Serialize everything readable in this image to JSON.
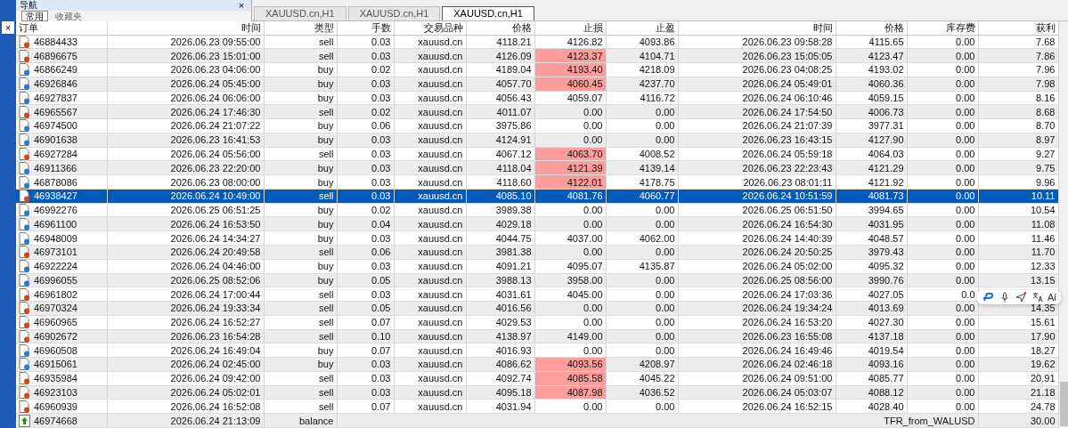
{
  "toolbox_close": "×",
  "navigator": {
    "title": "导航",
    "close": "×",
    "buttons": [
      "常用",
      "收藏夹"
    ]
  },
  "chart_tabs": [
    {
      "label": "XAUUSD.cn,H1",
      "selected": false
    },
    {
      "label": "XAUUSD.cn,H1",
      "selected": false
    },
    {
      "label": "XAUUSD.cn,H1",
      "selected": true
    }
  ],
  "table": {
    "columns": [
      "订单",
      "时间",
      "类型",
      "手数",
      "交易品种",
      "价格",
      "止损",
      "止盈",
      "时间",
      "价格",
      "库存费",
      "获利"
    ],
    "rows": [
      {
        "kind": "sell",
        "order": "46884433",
        "open_time": "2026.06.23 09:55:00",
        "type": "sell",
        "lots": "0.03",
        "symbol": "xauusd.cn",
        "price": "4118.21",
        "sl": "4126.82",
        "sl_highlight": false,
        "tp": "4093.86",
        "close_time": "2026.06.23 09:58:28",
        "close_price": "4115.65",
        "swap": "0.00",
        "profit": "7.68",
        "selected": false
      },
      {
        "kind": "sell",
        "order": "46896675",
        "open_time": "2026.06.23 15:01:00",
        "type": "sell",
        "lots": "0.03",
        "symbol": "xauusd.cn",
        "price": "4126.09",
        "sl": "4123.37",
        "sl_highlight": true,
        "tp": "4104.71",
        "close_time": "2026.06.23 15:05:05",
        "close_price": "4123.47",
        "swap": "0.00",
        "profit": "7.86",
        "selected": false
      },
      {
        "kind": "buy",
        "order": "46866249",
        "open_time": "2026.06.23 04:06:00",
        "type": "buy",
        "lots": "0.02",
        "symbol": "xauusd.cn",
        "price": "4189.04",
        "sl": "4193.40",
        "sl_highlight": true,
        "tp": "4218.09",
        "close_time": "2026.06.23 04:08:25",
        "close_price": "4193.02",
        "swap": "0.00",
        "profit": "7.96",
        "selected": false
      },
      {
        "kind": "buy",
        "order": "46926846",
        "open_time": "2026.06.24 05:45:00",
        "type": "buy",
        "lots": "0.03",
        "symbol": "xauusd.cn",
        "price": "4057.70",
        "sl": "4060.45",
        "sl_highlight": true,
        "tp": "4237.70",
        "close_time": "2026.06.24 05:49:01",
        "close_price": "4060.36",
        "swap": "0.00",
        "profit": "7.98",
        "selected": false
      },
      {
        "kind": "buy",
        "order": "46927837",
        "open_time": "2026.06.24 06:06:00",
        "type": "buy",
        "lots": "0.03",
        "symbol": "xauusd.cn",
        "price": "4056.43",
        "sl": "4059.07",
        "sl_highlight": false,
        "tp": "4116.72",
        "close_time": "2026.06.24 06:10:46",
        "close_price": "4059.15",
        "swap": "0.00",
        "profit": "8.16",
        "selected": false
      },
      {
        "kind": "sell",
        "order": "46965567",
        "open_time": "2026.06.24 17:46:30",
        "type": "sell",
        "lots": "0.02",
        "symbol": "xauusd.cn",
        "price": "4011.07",
        "sl": "0.00",
        "sl_highlight": false,
        "tp": "0.00",
        "close_time": "2026.06.24 17:54:50",
        "close_price": "4006.73",
        "swap": "0.00",
        "profit": "8.68",
        "selected": false
      },
      {
        "kind": "buy",
        "order": "46974500",
        "open_time": "2026.06.24 21:07:22",
        "type": "buy",
        "lots": "0.06",
        "symbol": "xauusd.cn",
        "price": "3975.86",
        "sl": "0.00",
        "sl_highlight": false,
        "tp": "0.00",
        "close_time": "2026.06.24 21:07:39",
        "close_price": "3977.31",
        "swap": "0.00",
        "profit": "8.70",
        "selected": false
      },
      {
        "kind": "buy",
        "order": "46901638",
        "open_time": "2026.06.23 16:41:53",
        "type": "buy",
        "lots": "0.03",
        "symbol": "xauusd.cn",
        "price": "4124.91",
        "sl": "0.00",
        "sl_highlight": false,
        "tp": "0.00",
        "close_time": "2026.06.23 16:43:15",
        "close_price": "4127.90",
        "swap": "0.00",
        "profit": "8.97",
        "selected": false
      },
      {
        "kind": "sell",
        "order": "46927284",
        "open_time": "2026.06.24 05:56:00",
        "type": "sell",
        "lots": "0.03",
        "symbol": "xauusd.cn",
        "price": "4067.12",
        "sl": "4063.70",
        "sl_highlight": true,
        "tp": "4008.52",
        "close_time": "2026.06.24 05:59:18",
        "close_price": "4064.03",
        "swap": "0.00",
        "profit": "9.27",
        "selected": false
      },
      {
        "kind": "buy",
        "order": "46911366",
        "open_time": "2026.06.23 22:20:00",
        "type": "buy",
        "lots": "0.03",
        "symbol": "xauusd.cn",
        "price": "4118.04",
        "sl": "4121.39",
        "sl_highlight": true,
        "tp": "4139.14",
        "close_time": "2026.06.23 22:23:43",
        "close_price": "4121.29",
        "swap": "0.00",
        "profit": "9.75",
        "selected": false
      },
      {
        "kind": "buy",
        "order": "46878086",
        "open_time": "2026.06.23 08:00:00",
        "type": "buy",
        "lots": "0.03",
        "symbol": "xauusd.cn",
        "price": "4118.60",
        "sl": "4122.01",
        "sl_highlight": true,
        "tp": "4178.75",
        "close_time": "2026.06.23 08:01:11",
        "close_price": "4121.92",
        "swap": "0.00",
        "profit": "9.96",
        "selected": false
      },
      {
        "kind": "sell",
        "order": "46938427",
        "open_time": "2026.06.24 10:49:00",
        "type": "sell",
        "lots": "0.03",
        "symbol": "xauusd.cn",
        "price": "4085.10",
        "sl": "4081.76",
        "sl_highlight": false,
        "tp": "4060.77",
        "close_time": "2026.06.24 10:51:59",
        "close_price": "4081.73",
        "swap": "0.00",
        "profit": "10.11",
        "selected": true
      },
      {
        "kind": "buy",
        "order": "46992276",
        "open_time": "2026.06.25 06:51:25",
        "type": "buy",
        "lots": "0.02",
        "symbol": "xauusd.cn",
        "price": "3989.38",
        "sl": "0.00",
        "sl_highlight": false,
        "tp": "0.00",
        "close_time": "2026.06.25 06:51:50",
        "close_price": "3994.65",
        "swap": "0.00",
        "profit": "10.54",
        "selected": false
      },
      {
        "kind": "buy",
        "order": "46961100",
        "open_time": "2026.06.24 16:53:50",
        "type": "buy",
        "lots": "0.04",
        "symbol": "xauusd.cn",
        "price": "4029.18",
        "sl": "0.00",
        "sl_highlight": false,
        "tp": "0.00",
        "close_time": "2026.06.24 16:54:30",
        "close_price": "4031.95",
        "swap": "0.00",
        "profit": "11.08",
        "selected": false
      },
      {
        "kind": "buy",
        "order": "46948009",
        "open_time": "2026.06.24 14:34:27",
        "type": "buy",
        "lots": "0.03",
        "symbol": "xauusd.cn",
        "price": "4044.75",
        "sl": "4037.00",
        "sl_highlight": false,
        "tp": "4062.00",
        "close_time": "2026.06.24 14:40:39",
        "close_price": "4048.57",
        "swap": "0.00",
        "profit": "11.46",
        "selected": false
      },
      {
        "kind": "sell",
        "order": "46973101",
        "open_time": "2026.06.24 20:49:58",
        "type": "sell",
        "lots": "0.06",
        "symbol": "xauusd.cn",
        "price": "3981.38",
        "sl": "0.00",
        "sl_highlight": false,
        "tp": "0.00",
        "close_time": "2026.06.24 20:50:25",
        "close_price": "3979.43",
        "swap": "0.00",
        "profit": "11.70",
        "selected": false
      },
      {
        "kind": "buy",
        "order": "46922224",
        "open_time": "2026.06.24 04:46:00",
        "type": "buy",
        "lots": "0.03",
        "symbol": "xauusd.cn",
        "price": "4091.21",
        "sl": "4095.07",
        "sl_highlight": false,
        "tp": "4135.87",
        "close_time": "2026.06.24 05:02:00",
        "close_price": "4095.32",
        "swap": "0.00",
        "profit": "12.33",
        "selected": false
      },
      {
        "kind": "buy",
        "order": "46996055",
        "open_time": "2026.06.25 08:52:06",
        "type": "buy",
        "lots": "0.05",
        "symbol": "xauusd.cn",
        "price": "3988.13",
        "sl": "3958.00",
        "sl_highlight": false,
        "tp": "0.00",
        "close_time": "2026.06.25 08:56:00",
        "close_price": "3990.76",
        "swap": "0.00",
        "profit": "13.15",
        "selected": false
      },
      {
        "kind": "sell",
        "order": "46961802",
        "open_time": "2026.06.24 17:00:44",
        "type": "sell",
        "lots": "0.03",
        "symbol": "xauusd.cn",
        "price": "4031.61",
        "sl": "4045.00",
        "sl_highlight": false,
        "tp": "0.00",
        "close_time": "2026.06.24 17:03:36",
        "close_price": "4027.05",
        "swap": "0.0",
        "selected": false
      },
      {
        "kind": "sell",
        "order": "46970324",
        "open_time": "2026.06.24 19:33:34",
        "type": "sell",
        "lots": "0.05",
        "symbol": "xauusd.cn",
        "price": "4016.56",
        "sl": "0.00",
        "sl_highlight": false,
        "tp": "0.00",
        "close_time": "2026.06.24 19:34:24",
        "close_price": "4013.69",
        "swap": "0.00",
        "profit": "14.35",
        "selected": false
      },
      {
        "kind": "sell",
        "order": "46960965",
        "open_time": "2026.06.24 16:52:27",
        "type": "sell",
        "lots": "0.07",
        "symbol": "xauusd.cn",
        "price": "4029.53",
        "sl": "0.00",
        "sl_highlight": false,
        "tp": "0.00",
        "close_time": "2026.06.24 16:53:20",
        "close_price": "4027.30",
        "swap": "0.00",
        "profit": "15.61",
        "selected": false
      },
      {
        "kind": "sell",
        "order": "46902672",
        "open_time": "2026.06.23 16:54:28",
        "type": "sell",
        "lots": "0.10",
        "symbol": "xauusd.cn",
        "price": "4138.97",
        "sl": "4149.00",
        "sl_highlight": false,
        "tp": "0.00",
        "close_time": "2026.06.23 16:55:08",
        "close_price": "4137.18",
        "swap": "0.00",
        "profit": "17.90",
        "selected": false
      },
      {
        "kind": "buy",
        "order": "46960508",
        "open_time": "2026.06.24 16:49:04",
        "type": "buy",
        "lots": "0.07",
        "symbol": "xauusd.cn",
        "price": "4016.93",
        "sl": "0.00",
        "sl_highlight": false,
        "tp": "0.00",
        "close_time": "2026.06.24 16:49:46",
        "close_price": "4019.54",
        "swap": "0.00",
        "profit": "18.27",
        "selected": false
      },
      {
        "kind": "buy",
        "order": "46915061",
        "open_time": "2026.06.24 02:45:00",
        "type": "buy",
        "lots": "0.03",
        "symbol": "xauusd.cn",
        "price": "4086.62",
        "sl": "4093.56",
        "sl_highlight": true,
        "tp": "4208.97",
        "close_time": "2026.06.24 02:46:18",
        "close_price": "4093.16",
        "swap": "0.00",
        "profit": "19.62",
        "selected": false
      },
      {
        "kind": "sell",
        "order": "46935984",
        "open_time": "2026.06.24 09:42:00",
        "type": "sell",
        "lots": "0.03",
        "symbol": "xauusd.cn",
        "price": "4092.74",
        "sl": "4085.58",
        "sl_highlight": true,
        "tp": "4045.22",
        "close_time": "2026.06.24 09:51:00",
        "close_price": "4085.77",
        "swap": "0.00",
        "profit": "20.91",
        "selected": false
      },
      {
        "kind": "sell",
        "order": "46923103",
        "open_time": "2026.06.24 05:02:01",
        "type": "sell",
        "lots": "0.03",
        "symbol": "xauusd.cn",
        "price": "4095.18",
        "sl": "4087.98",
        "sl_highlight": true,
        "tp": "4036.52",
        "close_time": "2026.06.24 05:03:07",
        "close_price": "4088.12",
        "swap": "0.00",
        "profit": "21.18",
        "selected": false
      },
      {
        "kind": "sell",
        "order": "46960939",
        "open_time": "2026.06.24 16:52:08",
        "type": "sell",
        "lots": "0.07",
        "symbol": "xauusd.cn",
        "price": "4031.94",
        "sl": "0.00",
        "sl_highlight": false,
        "tp": "0.00",
        "close_time": "2026.06.24 16:52:15",
        "close_price": "4028.40",
        "swap": "0.00",
        "profit": "24.78",
        "selected": false
      },
      {
        "kind": "balance",
        "order": "46974668",
        "open_time": "2026.06.24 21:13:09",
        "type": "balance",
        "comment": "TFR_from_WALUSD",
        "profit": "30.00",
        "selected": false
      }
    ]
  },
  "floating_toolbar": {
    "ai_label": "Ai"
  }
}
